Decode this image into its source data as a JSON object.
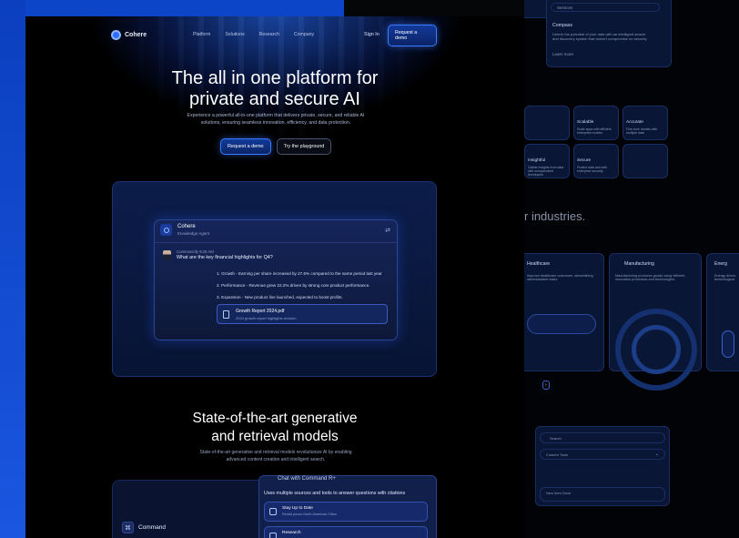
{
  "nav": {
    "brand": "Cohere",
    "links": [
      "Platform",
      "Solutions",
      "Research",
      "Company"
    ],
    "signin": "Sign In",
    "cta": "Request a demo"
  },
  "hero": {
    "title_line1": "The all in one platform for",
    "title_line2": "private and secure AI",
    "subtitle": "Experience a powerful all-in-one platform that delivers private, secure, and reliable AI solutions, ensuring seamless innovation, efficiency, and data protection.",
    "cta_primary": "Request a demo",
    "cta_secondary": "Try the playground"
  },
  "chat": {
    "agent_name": "Cohere",
    "agent_role": "Knowledge Agent",
    "question_meta": "Commonelly 9:25 AM",
    "question": "What are the key financial highlights for Q4?",
    "answers": [
      "1. Growth - Earning per share increased by 27.6% compared to the same period last year",
      "2. Performance - Revenue grew 22.2% driven by strong core product performance.",
      "3. Expansion - New product line launched, expected to boost profits."
    ],
    "file_name": "Growth Report 2024.pdf",
    "file_desc": "2024 growth report highlights revision"
  },
  "models": {
    "title_line1": "State-of-the-art generative",
    "title_line2": "and retrieval models",
    "subtitle": "State-of-the-art generative and retrieval models revolutionize AI by enabling advanced content creation and intelligent search."
  },
  "bottom": {
    "command_label": "Command",
    "side_head": "Chat with Command R+",
    "side_sub": "Uses multiple sources and tools to answer questions with citations",
    "tools": [
      {
        "title": "Stay Up to Date",
        "desc": "Rental prices North American Cities"
      },
      {
        "title": "Research",
        "desc": ""
      }
    ]
  },
  "right": {
    "top_item1": "Services",
    "compass_title": "Compass",
    "compass_desc": "Unlock the potential of your data with an intelligent search and discovery system that doesn't compromise on security.",
    "compass_link": "Learn more",
    "features": [
      {
        "title": "Scalable",
        "desc": "Scale apps with efficient enterprise models"
      },
      {
        "title": "Accurate",
        "desc": "Fine-tune models with multiple data"
      },
      {
        "title": "Insightful",
        "desc": "Gather insights from data with unsupervised techniques"
      },
      {
        "title": "Secure",
        "desc": "Protect data and with enterprise security"
      }
    ],
    "industries": "r industries.",
    "industry_cards": [
      {
        "title": "Healthcare",
        "desc": "Improve healthcare outcomes, streamlining administrative tasks"
      },
      {
        "title": "Manufacturing",
        "desc": "Manufacturing produces goods using efficient, innovative processes and technologies."
      },
      {
        "title": "Energ",
        "desc": "Energy drives technological"
      }
    ],
    "search_placeholder": "Search",
    "select_value": "Custom Tools",
    "new_item": "New Item Deck"
  },
  "colors": {
    "accent": "#2d6cff",
    "panel": "#0c1d4a",
    "bg": "#000000"
  }
}
